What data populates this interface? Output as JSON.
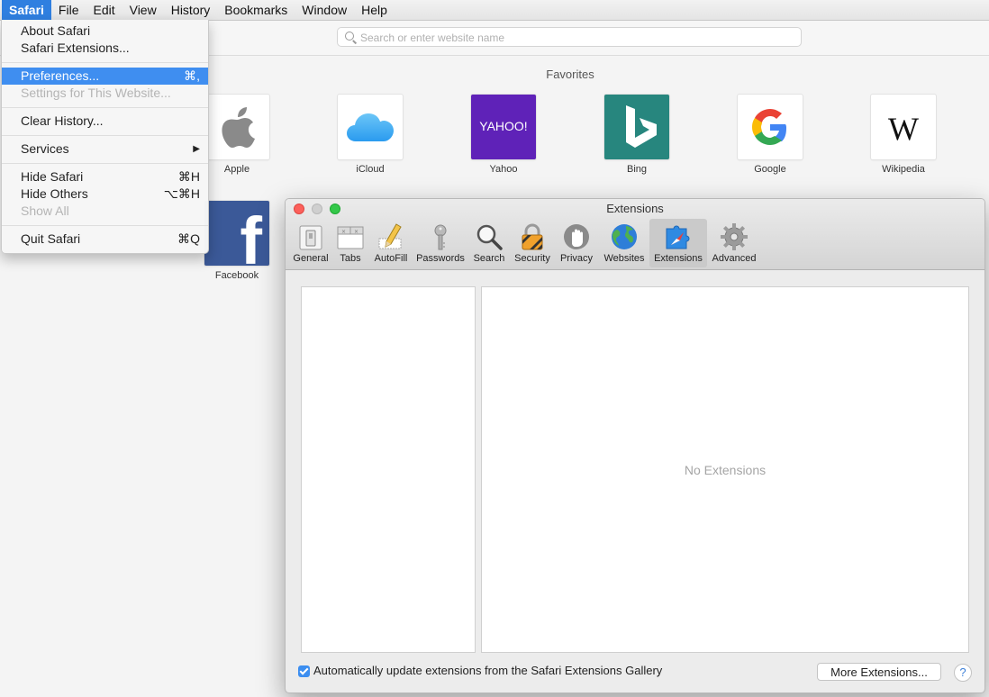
{
  "menubar": {
    "items": [
      "Safari",
      "File",
      "Edit",
      "View",
      "History",
      "Bookmarks",
      "Window",
      "Help"
    ]
  },
  "addressbar": {
    "placeholder": "Search or enter website name"
  },
  "favorites": {
    "title": "Favorites",
    "items": [
      {
        "label": "Apple",
        "icon": "apple-logo-icon"
      },
      {
        "label": "iCloud",
        "icon": "icloud-logo-icon"
      },
      {
        "label": "Yahoo",
        "icon": "yahoo-logo-icon",
        "tile_text": "YAHOO!"
      },
      {
        "label": "Bing",
        "icon": "bing-logo-icon"
      },
      {
        "label": "Google",
        "icon": "google-logo-icon"
      },
      {
        "label": "Wikipedia",
        "icon": "wikipedia-logo-icon",
        "tile_text": "W"
      },
      {
        "label": "Facebook",
        "icon": "facebook-logo-icon",
        "tile_text": "f"
      }
    ]
  },
  "safari_menu": {
    "items": [
      {
        "label": "About Safari",
        "shortcut": ""
      },
      {
        "label": "Safari Extensions...",
        "shortcut": ""
      },
      {
        "label": "Preferences...",
        "shortcut": "⌘,",
        "highlighted": true
      },
      {
        "label": "Settings for This Website...",
        "shortcut": "",
        "disabled": true
      },
      {
        "label": "Clear History...",
        "shortcut": ""
      },
      {
        "label": "Services",
        "shortcut": "▶"
      },
      {
        "label": "Hide Safari",
        "shortcut": "⌘H"
      },
      {
        "label": "Hide Others",
        "shortcut": "⌥⌘H"
      },
      {
        "label": "Show All",
        "shortcut": "",
        "disabled": true
      },
      {
        "label": "Quit Safari",
        "shortcut": "⌘Q"
      }
    ]
  },
  "prefs": {
    "title": "Extensions",
    "tabs": [
      "General",
      "Tabs",
      "AutoFill",
      "Passwords",
      "Search",
      "Security",
      "Privacy",
      "Websites",
      "Extensions",
      "Advanced"
    ],
    "selected_tab": "Extensions",
    "empty_text": "No Extensions",
    "auto_update_label": "Automatically update extensions from the Safari Extensions Gallery",
    "auto_update_checked": true,
    "more_button": "More Extensions...",
    "help_button": "?"
  },
  "colors": {
    "menu_highlight": "#3f8ef0",
    "checkbox": "#3c8ef0",
    "yahoo": "#5f22b8",
    "bing": "#27867e",
    "facebook": "#3b5998"
  }
}
